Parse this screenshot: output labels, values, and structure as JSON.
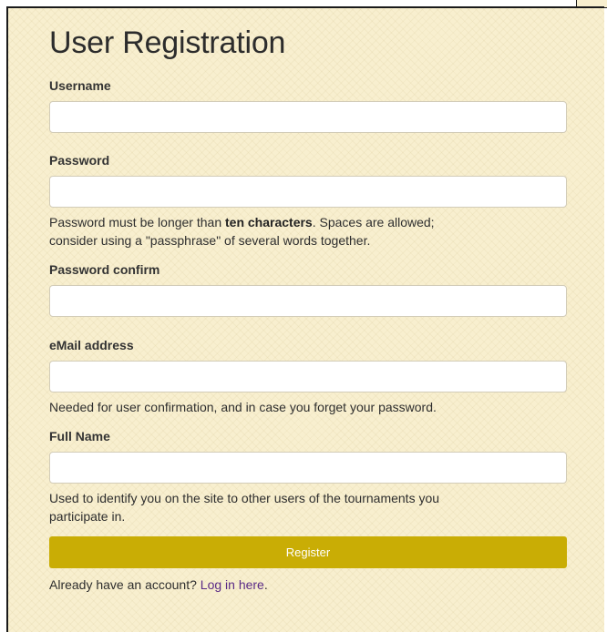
{
  "page": {
    "title": "User Registration"
  },
  "form": {
    "username": {
      "label": "Username",
      "value": "",
      "placeholder": ""
    },
    "password": {
      "label": "Password",
      "value": "",
      "placeholder": "",
      "help_before": "Password must be longer than ",
      "help_bold": "ten characters",
      "help_after": ". Spaces are allowed;",
      "help_line2": "consider using a \"passphrase\" of several words together."
    },
    "password_confirm": {
      "label": "Password confirm",
      "value": "",
      "placeholder": ""
    },
    "email": {
      "label": "eMail address",
      "value": "",
      "placeholder": "",
      "help": "Needed for user confirmation, and in case you forget your password."
    },
    "full_name": {
      "label": "Full Name",
      "value": "",
      "placeholder": "",
      "help_line1": "Used to identify you on the site to other users of the tournaments you",
      "help_line2": "participate in."
    },
    "register_label": "Register"
  },
  "footer": {
    "prompt": "Already have an account? ",
    "login_link": "Log in here",
    "suffix": "."
  },
  "colors": {
    "panel_background": "#f8efcf",
    "register_button": "#c9ad05",
    "link": "#5a2a86"
  }
}
